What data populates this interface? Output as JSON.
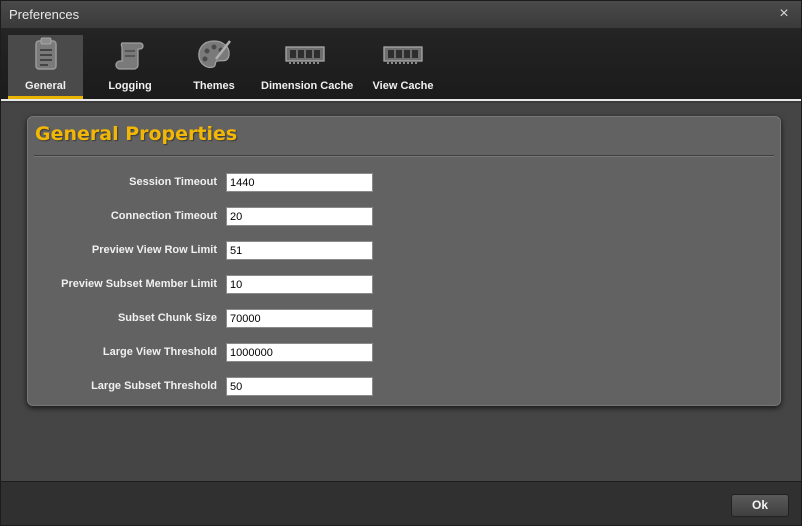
{
  "window": {
    "title": "Preferences",
    "close_glyph": "×"
  },
  "tabs": [
    {
      "label": "General",
      "icon": "clipboard-icon",
      "active": true
    },
    {
      "label": "Logging",
      "icon": "scroll-icon",
      "active": false
    },
    {
      "label": "Themes",
      "icon": "palette-icon",
      "active": false
    },
    {
      "label": "Dimension Cache",
      "icon": "memory-chip-icon",
      "active": false
    },
    {
      "label": "View Cache",
      "icon": "memory-chip-icon",
      "active": false
    }
  ],
  "panel": {
    "heading": "General Properties",
    "fields": [
      {
        "label": "Session Timeout",
        "value": "1440"
      },
      {
        "label": "Connection Timeout",
        "value": "20"
      },
      {
        "label": "Preview View Row Limit",
        "value": "51"
      },
      {
        "label": "Preview Subset Member Limit",
        "value": "10"
      },
      {
        "label": "Subset Chunk Size",
        "value": "70000"
      },
      {
        "label": "Large View Threshold",
        "value": "1000000"
      },
      {
        "label": "Large Subset Threshold",
        "value": "50"
      }
    ]
  },
  "footer": {
    "ok_label": "Ok"
  },
  "colors": {
    "accent": "#f2b705",
    "active_tab_underline": "#e8b400"
  }
}
